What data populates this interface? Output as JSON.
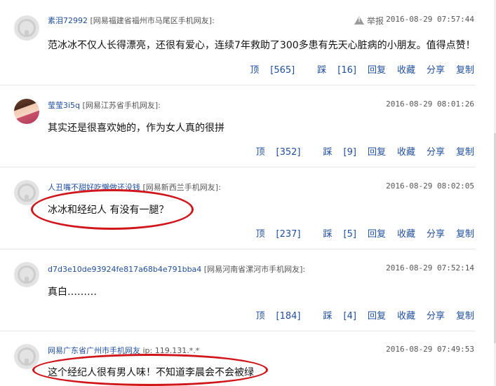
{
  "comments": [
    {
      "user": "素泪72992",
      "location": "[网易福建省福州市马尾区手机网友]:",
      "report_label": "举报",
      "time": "2016-08-29 07:57:44",
      "text": "范冰冰不仅人长得漂亮，还很有爱心，连续7年救助了300多患有先天心脏病的小朋友。值得点赞！",
      "up_label": "顶",
      "up_count": "[565]",
      "down_label": "踩",
      "down_count": "[16]",
      "reply_label": "回复",
      "fav_label": "收藏",
      "share_label": "分享",
      "copy_label": "复制"
    },
    {
      "user": "莹莹3i5q",
      "location": "[网易江苏省手机网友]:",
      "time": "2016-08-29 08:01:26",
      "text": "其实还是很喜欢她的，作为女人真的很拼",
      "up_label": "顶",
      "up_count": "[352]",
      "down_label": "踩",
      "down_count": "[9]",
      "reply_label": "回复",
      "fav_label": "收藏",
      "share_label": "分享",
      "copy_label": "复制"
    },
    {
      "user": "人丑嘴不甜好吃懒做还没钱",
      "location": "[网易新西兰手机网友]:",
      "time": "2016-08-29 08:02:05",
      "text": "冰冰和经纪人  有没有一腿？",
      "up_label": "顶",
      "up_count": "[237]",
      "down_label": "踩",
      "down_count": "[5]",
      "reply_label": "回复",
      "fav_label": "收藏",
      "share_label": "分享",
      "copy_label": "复制"
    },
    {
      "user": "d7d3e10de93924fe817a68b4e791bba4",
      "location": "[网易河南省漯河市手机网友]:",
      "time": "2016-08-29 07:52:14",
      "text": "真白………",
      "up_label": "顶",
      "up_count": "[184]",
      "down_label": "踩",
      "down_count": "[4]",
      "reply_label": "回复",
      "fav_label": "收藏",
      "share_label": "分享",
      "copy_label": "复制"
    },
    {
      "user": "网易广东省广州市手机网友",
      "location": "ip: 119.131.*.*",
      "time": "2016-08-29 07:49:53",
      "text": "这个经纪人很有男人味！不知道李晨会不会被绿"
    }
  ],
  "colors": {
    "link": "#1f4e9c",
    "annotation": "#d0151b"
  }
}
